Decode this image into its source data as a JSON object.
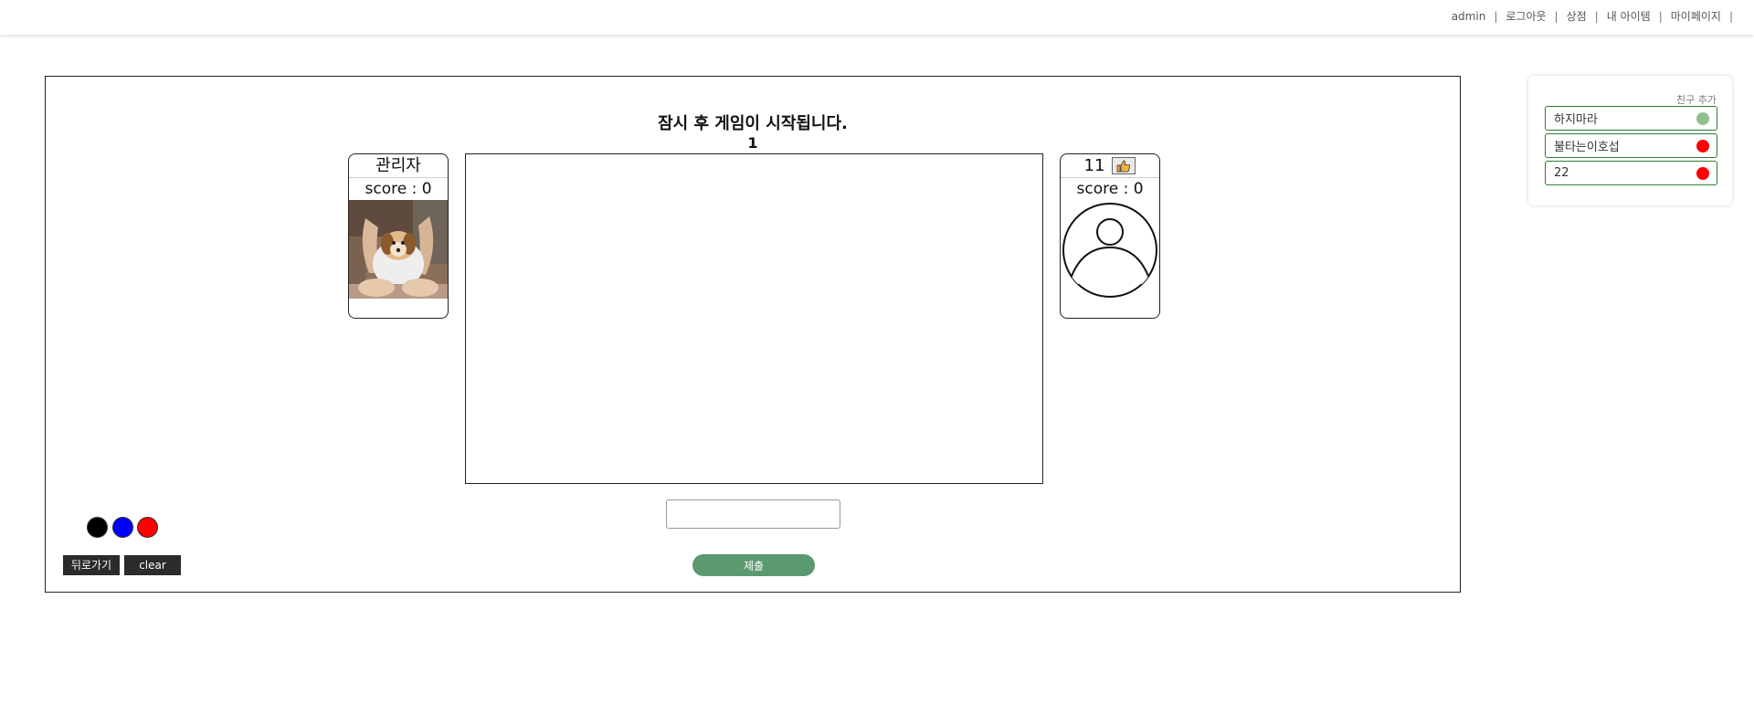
{
  "nav": {
    "links": [
      "admin",
      "로그아웃",
      "상점",
      "내 아이템",
      "마이페이지"
    ],
    "separator": "|"
  },
  "game": {
    "status": "잠시 후 게임이 시작됩니다.",
    "countdown": "1",
    "players": [
      {
        "name": "관리자",
        "score_label": "score : 0",
        "avatar": "photo"
      },
      {
        "name": "11",
        "score_label": "score : 0",
        "avatar": "default-user-icon",
        "like_icon": "thumbs-up-icon"
      }
    ],
    "palette": {
      "colors": [
        "#000000",
        "#0000ff",
        "#ff0000"
      ]
    },
    "buttons": {
      "back_label": "뒤로가기",
      "clear_label": "clear",
      "submit_label": "제출"
    },
    "answer_input": {
      "value": "",
      "placeholder": ""
    }
  },
  "friends": {
    "add_label": "친구 추가",
    "list": [
      {
        "name": "하지마라",
        "status_color": "#8fc18f"
      },
      {
        "name": "불타는이호섭",
        "status_color": "#ff0000"
      },
      {
        "name": "22",
        "status_color": "#ff0000"
      }
    ]
  },
  "colors": {
    "accent_green": "#5b9a6f",
    "friend_border": "#2e7d32",
    "dark_button": "#2b2b2b"
  }
}
